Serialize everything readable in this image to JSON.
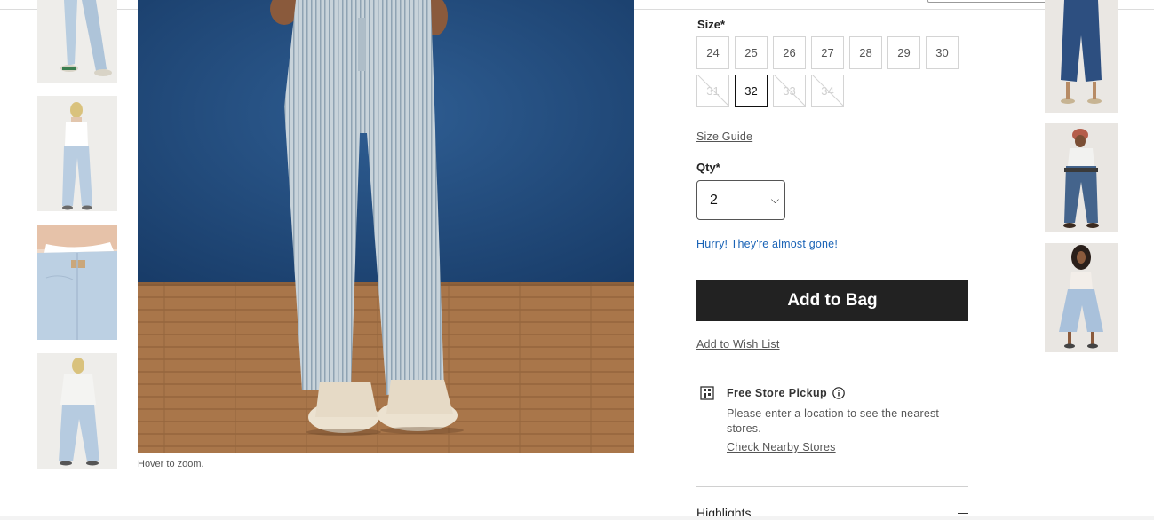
{
  "main": {
    "hover_text": "Hover to zoom."
  },
  "left_thumbnails": [
    {
      "icon": "product-thumbnail-full-front"
    },
    {
      "icon": "product-thumbnail-back"
    },
    {
      "icon": "product-thumbnail-waist-detail"
    },
    {
      "icon": "product-thumbnail-full-model"
    }
  ],
  "options": {
    "size_label": "Size*",
    "sizes": [
      {
        "label": "24",
        "state": "available"
      },
      {
        "label": "25",
        "state": "available"
      },
      {
        "label": "26",
        "state": "available"
      },
      {
        "label": "27",
        "state": "available"
      },
      {
        "label": "28",
        "state": "available"
      },
      {
        "label": "29",
        "state": "available"
      },
      {
        "label": "30",
        "state": "available"
      },
      {
        "label": "31",
        "state": "unavailable"
      },
      {
        "label": "32",
        "state": "selected"
      },
      {
        "label": "33",
        "state": "unavailable"
      },
      {
        "label": "34",
        "state": "unavailable"
      }
    ],
    "size_guide": "Size Guide",
    "qty_label": "Qty*",
    "qty_value": "2",
    "stock_message": "Hurry! They're almost gone!",
    "add_to_bag": "Add to Bag",
    "wish_list": "Add to Wish List"
  },
  "pickup": {
    "title": "Free Store Pickup",
    "description": "Please enter a location to see the nearest stores.",
    "link": "Check Nearby Stores"
  },
  "accordion": {
    "highlights": "Highlights"
  },
  "colors": {
    "button_bg": "#222222",
    "link_blue": "#1a63b6",
    "selected_border": "#111111"
  }
}
